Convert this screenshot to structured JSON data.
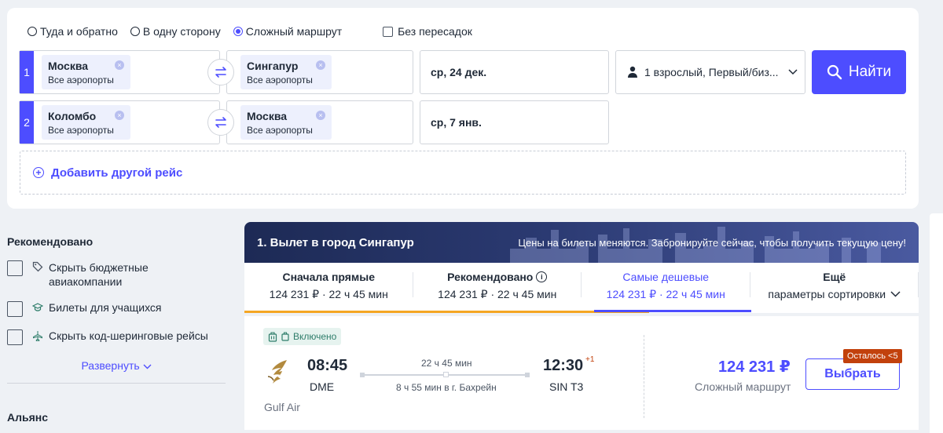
{
  "search": {
    "trip_types": [
      {
        "label": "Туда и обратно",
        "selected": false
      },
      {
        "label": "В одну сторону",
        "selected": false
      },
      {
        "label": "Сложный маршрут",
        "selected": true
      }
    ],
    "nonstop_label": "Без пересадок",
    "legs": [
      {
        "num": "1",
        "from_city": "Москва",
        "from_sub": "Все аэропорты",
        "to_city": "Сингапур",
        "to_sub": "Все аэропорты",
        "date": "ср, 24 дек."
      },
      {
        "num": "2",
        "from_city": "Коломбо",
        "from_sub": "Все аэропорты",
        "to_city": "Москва",
        "to_sub": "Все аэропорты",
        "date": "ср, 7 янв."
      }
    ],
    "passengers": "1 взрослый, Первый/биз...",
    "find_label": "Найти",
    "add_flight_label": "Добавить другой рейс",
    "accent_color": "#4d4dff"
  },
  "filters": {
    "recommended_title": "Рекомендовано",
    "items": [
      {
        "label": "Скрыть бюджетные авиакомпании",
        "icon": "tag-icon"
      },
      {
        "label": "Билеты для учащихся",
        "icon": "graduation-cap-icon"
      },
      {
        "label": "Скрыть код-шеринговые рейсы",
        "icon": "plane-icon"
      }
    ],
    "expand_label": "Развернуть",
    "alliance_title": "Альянс"
  },
  "results": {
    "banner_title": "1. Вылет в город Сингапур",
    "banner_note": "Цены на билеты меняются. Забронируйте сейчас, чтобы получить текущую цену!",
    "sort_tabs": [
      {
        "title": "Сначала прямые",
        "value": "124 231 ₽ · 22 ч 45 мин",
        "active": false
      },
      {
        "title": "Рекомендовано",
        "value": "124 231 ₽ · 22 ч 45 мин",
        "active": false
      },
      {
        "title": "Самые дешевые",
        "value": "124 231 ₽ · 22 ч 45 мин",
        "active": true
      },
      {
        "title": "Ещё",
        "value": "параметры сортировки",
        "active": false
      }
    ],
    "flight": {
      "included_label": "Включено",
      "airline": "Gulf Air",
      "dep_time": "08:45",
      "dep_airport": "DME",
      "arr_time": "12:30",
      "arr_day_offset": "+1",
      "arr_airport": "SIN T3",
      "duration": "22 ч 45 мин",
      "stop_info": "8 ч 55 мин в г. Бахрейн",
      "price": "124 231 ₽",
      "price_note": "Сложный маршрут",
      "select_label": "Выбрать",
      "seats_badge": "Осталось <5"
    }
  }
}
